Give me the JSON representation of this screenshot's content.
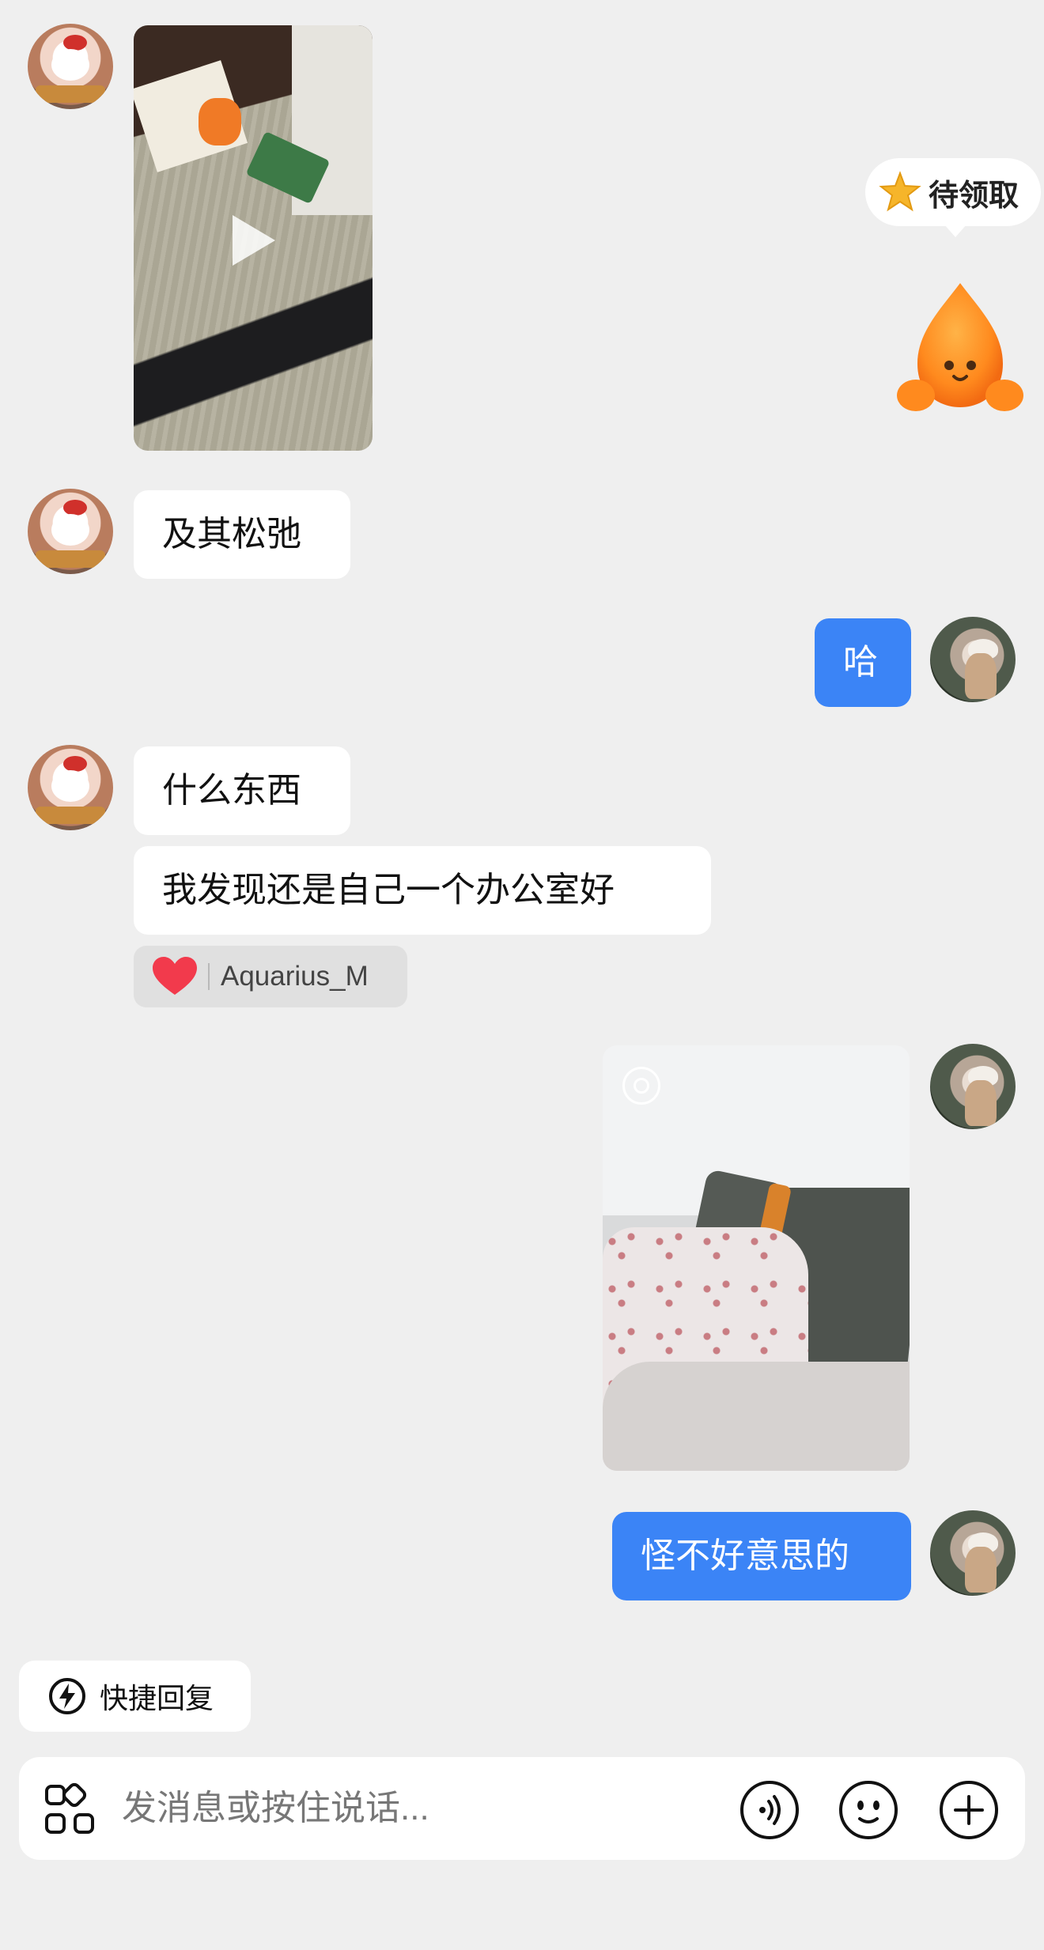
{
  "messages": [
    {
      "side": "in",
      "type": "video",
      "sender": "hello-kitty-avatar"
    },
    {
      "side": "in",
      "type": "text",
      "text": "及其松弛"
    },
    {
      "side": "out",
      "type": "text",
      "text": "哈"
    },
    {
      "side": "in",
      "type": "text",
      "text": "什么东西"
    },
    {
      "side": "in",
      "type": "text",
      "text": "我发现还是自己一个办公室好"
    },
    {
      "side": "out",
      "type": "live-photo"
    },
    {
      "side": "out",
      "type": "text",
      "text": "怪不好意思的"
    }
  ],
  "reaction": {
    "emoji": "heart-icon",
    "user": "Aquarius_M"
  },
  "reward": {
    "label": "待领取",
    "icon": "star-icon"
  },
  "quick_reply": {
    "label": "快捷回复"
  },
  "composer": {
    "placeholder": "发消息或按住说话...",
    "icons": [
      "apps-icon",
      "voice-icon",
      "emoji-icon",
      "plus-icon"
    ]
  },
  "colors": {
    "background": "#efefef",
    "outgoing_bubble": "#3b84f6",
    "incoming_bubble": "#ffffff",
    "mascot": "#ff8a1e"
  }
}
